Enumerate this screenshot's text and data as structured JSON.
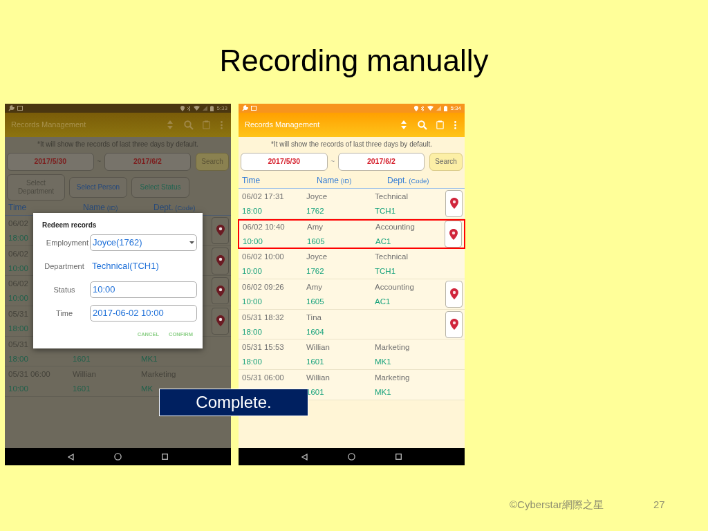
{
  "slide": {
    "title": "Recording manually",
    "callout": "Complete.",
    "footer": "©Cyberstar網際之星",
    "page_number": "27"
  },
  "phones": [
    {
      "dimmed": true,
      "clock": "5:33",
      "app_title": "Records Management",
      "notice": "*It will show the records of last three days by default.",
      "date_from": "2017/5/30",
      "date_separator": "~",
      "date_to": "2017/6/2",
      "search_button": "Search",
      "filter_buttons": [
        {
          "label": "Select Department",
          "color": "#4b4940"
        },
        {
          "label": "Select Person",
          "color": "#24487c"
        },
        {
          "label": "Select Status",
          "color": "#1f6450"
        }
      ],
      "columns": [
        {
          "label": "Time"
        },
        {
          "label": "Name",
          "unit": "(ID)"
        },
        {
          "label": "Dept.",
          "unit": "(Code)"
        }
      ],
      "rows": [
        {
          "time": "06/02",
          "status": "18:00",
          "pin": true,
          "highlighted": false
        },
        {
          "time": "06/02",
          "status": "10:00",
          "pin": true,
          "highlighted": false
        },
        {
          "time": "06/02",
          "status": "10:00",
          "pin": true,
          "highlighted": false
        },
        {
          "time": "05/31",
          "status": "18:00",
          "pin": true,
          "highlighted": false
        },
        {
          "time": "05/31",
          "status": "18:00",
          "id": "1601",
          "code": "MK1",
          "pin": false,
          "highlighted": false
        },
        {
          "time": "05/31 06:00",
          "name": "Willian",
          "dept": "Marketing",
          "status": "10:00",
          "id": "1601",
          "code": "MK",
          "pin": false,
          "highlighted": false
        }
      ],
      "dialog": {
        "title": "Redeem records",
        "fields": [
          {
            "label": "Employment",
            "value": "Joyce(1762)",
            "kind": "select"
          },
          {
            "label": "Department",
            "value": "Technical(TCH1)",
            "kind": "text"
          },
          {
            "label": "Status",
            "value": "10:00",
            "kind": "input"
          },
          {
            "label": "Time",
            "value": "2017-06-02 10:00",
            "kind": "input"
          }
        ],
        "buttons": [
          "CANCEL",
          "CONFIRM"
        ]
      }
    },
    {
      "dimmed": false,
      "clock": "5:34",
      "app_title": "Records Management",
      "notice": "*It will show the records of last three days by default.",
      "date_from": "2017/5/30",
      "date_separator": "~",
      "date_to": "2017/6/2",
      "search_button": "Search",
      "columns": [
        {
          "label": "Time"
        },
        {
          "label": "Name",
          "unit": "(ID)"
        },
        {
          "label": "Dept.",
          "unit": "(Code)"
        }
      ],
      "rows": [
        {
          "time": "06/02 17:31",
          "name": "Joyce",
          "dept": "Technical",
          "status": "18:00",
          "id": "1762",
          "code": "TCH1",
          "pin": true,
          "highlighted": false
        },
        {
          "time": "06/02 10:40",
          "name": "Amy",
          "dept": "Accounting",
          "status": "10:00",
          "id": "1605",
          "code": "AC1",
          "pin": true,
          "highlighted": true
        },
        {
          "time": "06/02 10:00",
          "name": "Joyce",
          "dept": "Technical",
          "status": "10:00",
          "id": "1762",
          "code": "TCH1",
          "pin": false,
          "highlighted": false
        },
        {
          "time": "06/02 09:26",
          "name": "Amy",
          "dept": "Accounting",
          "status": "10:00",
          "id": "1605",
          "code": "AC1",
          "pin": true,
          "highlighted": false
        },
        {
          "time": "05/31 18:32",
          "name": "Tina",
          "status": "18:00",
          "id": "1604",
          "pin": true,
          "highlighted": false
        },
        {
          "time": "05/31 15:53",
          "name": "Willian",
          "dept": "Marketing",
          "status": "18:00",
          "id": "1601",
          "code": "MK1",
          "pin": false,
          "highlighted": false
        },
        {
          "time": "05/31 06:00",
          "name": "Willian",
          "dept": "Marketing",
          "id": "1601",
          "code": "MK1",
          "pin": false,
          "highlighted": false
        }
      ]
    }
  ]
}
